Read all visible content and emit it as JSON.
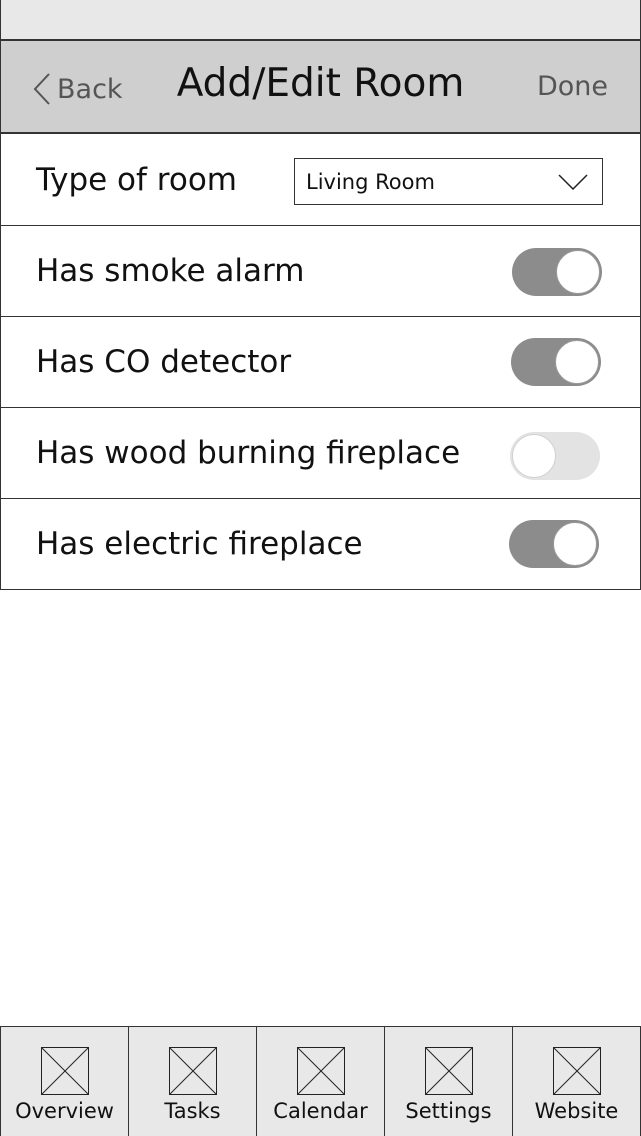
{
  "nav": {
    "back_label": "Back",
    "title": "Add/Edit Room",
    "done_label": "Done"
  },
  "form": {
    "room_type": {
      "label": "Type of room",
      "selected": "Living Room"
    },
    "toggles": [
      {
        "label": "Has smoke alarm",
        "on": true
      },
      {
        "label": "Has CO detector",
        "on": true
      },
      {
        "label": "Has wood burning fireplace",
        "on": false
      },
      {
        "label": "Has electric fireplace",
        "on": true
      }
    ]
  },
  "tabs": [
    {
      "label": "Overview",
      "icon": "placeholder-image-icon"
    },
    {
      "label": "Tasks",
      "icon": "placeholder-image-icon"
    },
    {
      "label": "Calendar",
      "icon": "placeholder-image-icon"
    },
    {
      "label": "Settings",
      "icon": "placeholder-image-icon"
    },
    {
      "label": "Website",
      "icon": "placeholder-image-icon"
    }
  ],
  "colors": {
    "nav_background": "#cfcfcf",
    "toggle_on": "#8c8c8c",
    "toggle_off": "#e3e3e3",
    "tab_bar_background": "#e8e8e8"
  }
}
